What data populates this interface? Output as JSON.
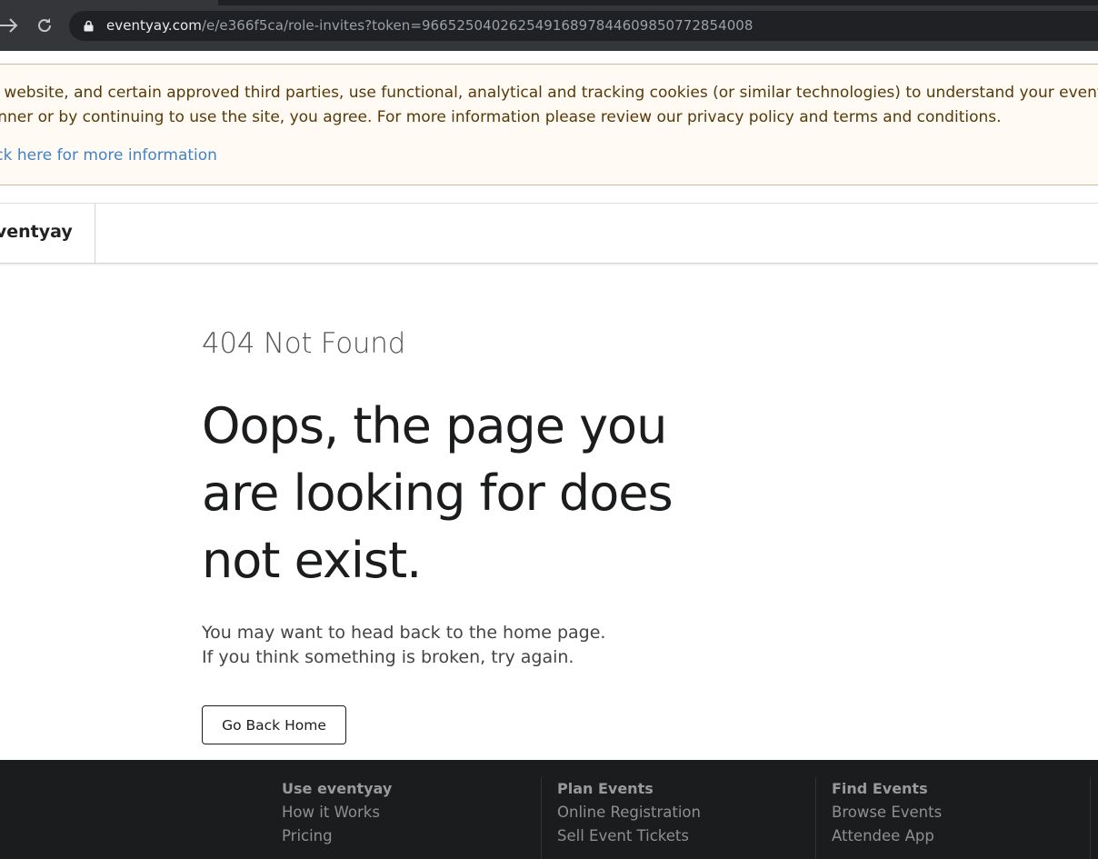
{
  "browser": {
    "url_host": "eventyay.com",
    "url_path": "/e/e366f5ca/role-invites?token=96652504026254916897844609850772854008"
  },
  "cookie_banner": {
    "line1": "this website, and certain approved third parties, use functional, analytical and tracking cookies (or similar technologies) to understand your event preferences",
    "line2": "banner or by continuing to use the site, you agree. For more information please review our privacy policy and terms and conditions.",
    "link": "Click here for more information"
  },
  "navbar": {
    "brand": "eventyay"
  },
  "error": {
    "code": "404 Not Found",
    "title": "Oops, the page you are looking for does not exist.",
    "message_line1": "You may want to head back to the home page.",
    "message_line2": "If you think something is broken, try again.",
    "button": "Go Back Home"
  },
  "footer": {
    "col1": {
      "heading": "Use eventyay",
      "items": [
        "How it Works",
        "Pricing"
      ]
    },
    "col2": {
      "heading": "Plan Events",
      "items": [
        "Online Registration",
        "Sell Event Tickets"
      ]
    },
    "col3": {
      "heading": "Find Events",
      "items": [
        "Browse Events",
        "Attendee App"
      ]
    }
  }
}
